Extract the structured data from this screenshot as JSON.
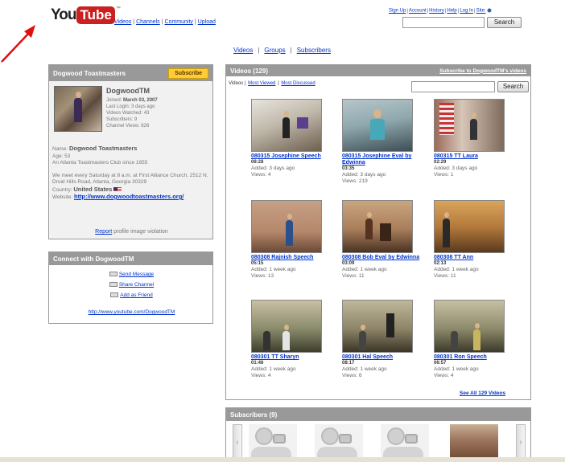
{
  "header": {
    "logo_you": "You",
    "logo_tube": "Tube",
    "logo_tm": "™",
    "nav": [
      "Videos",
      "Channels",
      "Community",
      "Upload"
    ],
    "util_nav": [
      "Sign Up",
      "Account",
      "History",
      "Help",
      "Log In",
      "Site:"
    ],
    "search_button": "Search"
  },
  "channel_nav": [
    "Videos",
    "Groups",
    "Subscribers"
  ],
  "profile": {
    "box_title": "Dogwood Toastmasters",
    "subscribe_label": "Subscribe",
    "username": "DogwoodTM",
    "stats": [
      {
        "label": "Joined:",
        "value": "March 03, 2007"
      },
      {
        "label": "Last Login:",
        "value": "3 days ago"
      },
      {
        "label": "Videos Watched:",
        "value": "43"
      },
      {
        "label": "Subscribers:",
        "value": "9"
      },
      {
        "label": "Channel Views:",
        "value": "826"
      }
    ],
    "name_label": "Name:",
    "name_value": "Dogwood Toastmasters",
    "age": "Age: 53",
    "about": "An Atlanta Toastmasters Club since 1955",
    "meeting": "We meet every Saturday at 8 a.m. at First Alliance Church, 2512 N. Druid Hills Road, Atlanta, Georgia 30329",
    "country_label": "Country:",
    "country_value": "United States",
    "website_label": "Website:",
    "website_value": "http://www.dogwoodtoastmasters.org/",
    "report_link": "Report",
    "report_rest": "profile image violation"
  },
  "connect": {
    "title": "Connect with DogwoodTM",
    "send_message": "Send Message",
    "share_channel": "Share Channel",
    "add_friend": "Add as Friend",
    "channel_url": "http://www.youtube.com/DogwoodTM"
  },
  "videos": {
    "title": "Videos (129)",
    "subscribe_link": "Subscribe to DogwoodTM's videos",
    "tab_videos": "Videos",
    "tab_most_viewed": "Most Viewed",
    "tab_most_discussed": "Most Discussed",
    "search_button": "Search",
    "items": [
      {
        "title": "080315 Josephine Speech",
        "duration": "08:28",
        "added": "Added: 3 days ago",
        "views": "Views: 4"
      },
      {
        "title": "080315 Josephine Eval by Edwinna",
        "duration": "03:35",
        "added": "Added: 3 days ago",
        "views": "Views: 219"
      },
      {
        "title": "080315 TT Laura",
        "duration": "02:29",
        "added": "Added: 3 days ago",
        "views": "Views: 1"
      },
      {
        "title": "080308 Rajnish Speech",
        "duration": "05:15",
        "added": "Added: 1 week ago",
        "views": "Views: 13"
      },
      {
        "title": "080308 Bob Eval by Edwinna",
        "duration": "03:09",
        "added": "Added: 1 week ago",
        "views": "Views: 11"
      },
      {
        "title": "080308 TT Ann",
        "duration": "02:13",
        "added": "Added: 1 week ago",
        "views": "Views: 11"
      },
      {
        "title": "080301 TT Sharyn",
        "duration": "01:46",
        "added": "Added: 1 week ago",
        "views": "Views: 4"
      },
      {
        "title": "080301 Hal Speech",
        "duration": "08:17",
        "added": "Added: 1 week ago",
        "views": "Views: 6"
      },
      {
        "title": "080301 Ron Speech",
        "duration": "06:57",
        "added": "Added: 1 week ago",
        "views": "Views: 4"
      }
    ],
    "see_all": "See All 129 Videos"
  },
  "subscribers": {
    "title": "Subscribers (9)"
  },
  "colors": {
    "link": "#0033cc",
    "box_header": "#999999",
    "subscribe_button": "#ffcc33",
    "logo_red": "#cc1f1f",
    "arrow": "#e01010"
  }
}
